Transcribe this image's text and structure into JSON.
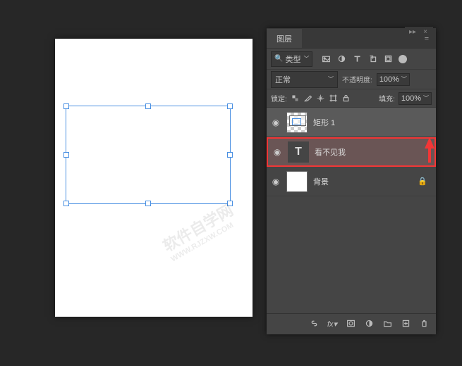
{
  "panel": {
    "collapse_arrows": "▸▸",
    "close_x": "×",
    "tab_label": "图层",
    "menu_glyph": "≡",
    "type_filter_label": "类型",
    "blend_mode": "正常",
    "opacity_label": "不透明度:",
    "opacity_value": "100%",
    "lock_label": "锁定:",
    "fill_label": "填充:",
    "fill_value": "100%"
  },
  "layers": [
    {
      "name": "矩形 1",
      "visible": "◉",
      "selected": true,
      "type": "shape"
    },
    {
      "name": "看不见我",
      "visible": "◉",
      "selected": false,
      "type": "text",
      "highlight": true
    },
    {
      "name": "背景",
      "visible": "◉",
      "selected": false,
      "type": "solid",
      "locked": "🔒"
    }
  ],
  "watermark": {
    "main": "软件自学网",
    "sub": "WWW.RJZXW.COM"
  }
}
